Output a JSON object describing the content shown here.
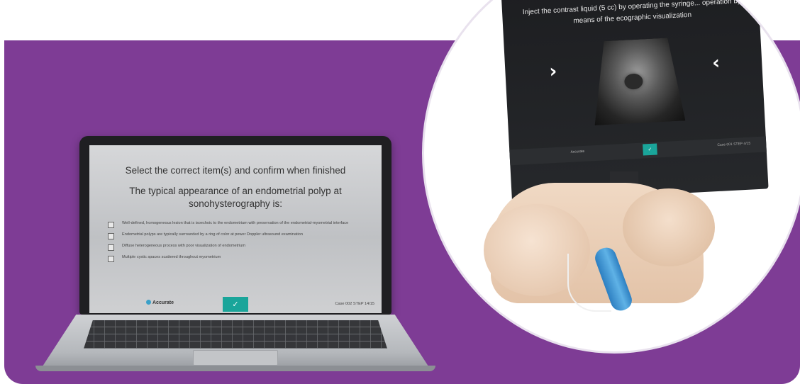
{
  "laptop_screen": {
    "heading": "Select the correct item(s) and confirm when finished",
    "question": "The typical appearance of an endometrial polyp at sonohysterography is:",
    "options": [
      "Well-defined, homogeneous lesion that is isoechoic to the endometrium with preservation of the endometrial-myometrial interface",
      "Endometrial polyps are typically surrounded by a ring of color at power Doppler ultrasound examination",
      "Diffuse heterogeneous process with poor visualization of endometrium",
      "Multiple cystic spaces scattered throughout myometrium"
    ],
    "footer": {
      "brand_name": "Accurate",
      "confirm_icon": "check-icon",
      "case_info": "Case 002  STEP 14/15"
    }
  },
  "monitor_screen": {
    "instruction": "Inject the contrast liquid (5 cc) by operating the syringe... operation by means of the ecographic visualization",
    "nav_left_icon": "chevron-right-icon",
    "nav_right_icon": "chevron-left-icon",
    "footer": {
      "brand_name": "Accurate",
      "case_info": "Case 001  STEP 4/15"
    }
  },
  "colors": {
    "background_band": "#7e3c95",
    "confirm_button": "#1aa59a",
    "probe": "#4aa3da"
  }
}
